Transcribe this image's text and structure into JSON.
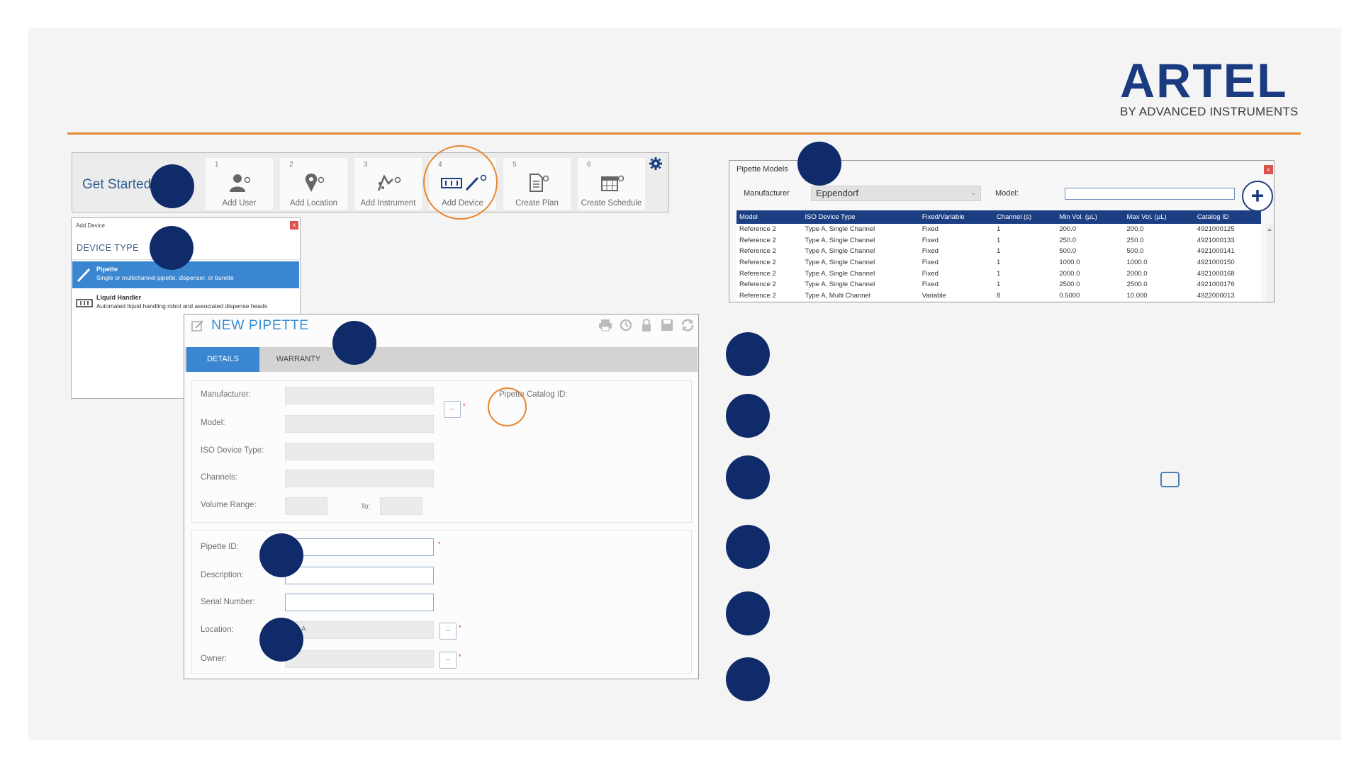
{
  "brand": {
    "name": "ARTEL",
    "tagline": "BY ADVANCED INSTRUMENTS",
    "accent": "#e58a33",
    "navy": "#102b6a"
  },
  "toolbar": {
    "get_started": "Get Started",
    "steps": [
      {
        "num": "1",
        "label": "Add User",
        "icon": "add-user-icon"
      },
      {
        "num": "2",
        "label": "Add Location",
        "icon": "add-location-icon"
      },
      {
        "num": "3",
        "label": "Add Instrument",
        "icon": "add-instrument-icon"
      },
      {
        "num": "4",
        "label": "Add Device",
        "icon": "add-device-icon"
      },
      {
        "num": "5",
        "label": "Create Plan",
        "icon": "create-plan-icon"
      },
      {
        "num": "6",
        "label": "Create Schedule",
        "icon": "create-schedule-icon"
      }
    ]
  },
  "add_device": {
    "title": "Add Device",
    "heading": "DEVICE TYPE",
    "items": [
      {
        "name": "Pipette",
        "desc": "Single or multichannel pipette, dispenser, or burette"
      },
      {
        "name": "Liquid Handler",
        "desc": "Automated liquid handling robot and associated dispense heads"
      }
    ]
  },
  "form": {
    "title": "NEW PIPETTE",
    "tabs": [
      "DETAILS",
      "WARRANTY"
    ],
    "labels": {
      "manufacturer": "Manufacturer:",
      "catalog_id": "Pipette Catalog ID:",
      "model": "Model:",
      "iso_type": "ISO Device Type:",
      "channels": "Channels:",
      "volume_range": "Volume Range:",
      "to": "To:",
      "pipette_id": "Pipette ID:",
      "description": "Description:",
      "serial": "Serial Number:",
      "location": "Location:",
      "owner": "Owner:"
    },
    "values": {
      "location": "Lab A"
    },
    "browse": "...",
    "required": "*"
  },
  "models": {
    "title": "Pipette Models",
    "manufacturer_label": "Manufacturer",
    "manufacturer_value": "Eppendorf",
    "model_label": "Model:",
    "add_symbol": "+",
    "columns": [
      "Model",
      "ISO Device Type",
      "Fixed/Variable",
      "Channel (s)",
      "Min Vol. (µL)",
      "Max Vol. (µL)",
      "Catalog ID"
    ],
    "rows": [
      [
        "Reference 2",
        "Type A, Single Channel",
        "Fixed",
        "1",
        "200.0",
        "200.0",
        "4921000125"
      ],
      [
        "Reference 2",
        "Type A, Single Channel",
        "Fixed",
        "1",
        "250.0",
        "250.0",
        "4921000133"
      ],
      [
        "Reference 2",
        "Type A, Single Channel",
        "Fixed",
        "1",
        "500.0",
        "500.0",
        "4921000141"
      ],
      [
        "Reference 2",
        "Type A, Single Channel",
        "Fixed",
        "1",
        "1000.0",
        "1000.0",
        "4921000150"
      ],
      [
        "Reference 2",
        "Type A, Single Channel",
        "Fixed",
        "1",
        "2000.0",
        "2000.0",
        "4921000168"
      ],
      [
        "Reference 2",
        "Type A, Single Channel",
        "Fixed",
        "1",
        "2500.0",
        "2500.0",
        "4921000176"
      ],
      [
        "Reference 2",
        "Type A, Multi Channel",
        "Variable",
        "8",
        "0.5000",
        "10.000",
        "4922000013"
      ]
    ]
  }
}
